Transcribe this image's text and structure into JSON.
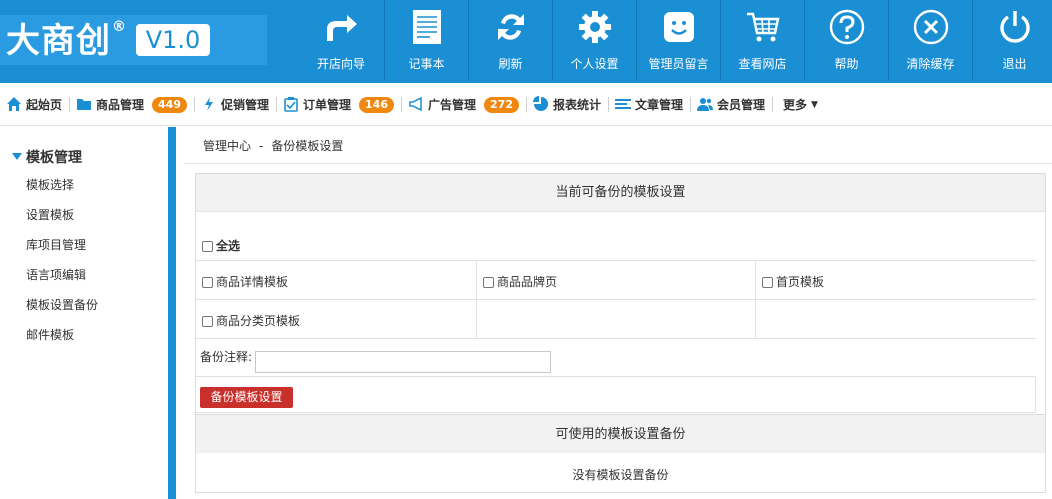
{
  "brand": {
    "name": "大商创",
    "reg": "®",
    "version": "V1.0"
  },
  "top_tools": [
    {
      "label": "开店向导",
      "icon": "share-arrow-icon"
    },
    {
      "label": "记事本",
      "icon": "notepad-icon"
    },
    {
      "label": "刷新",
      "icon": "refresh-icon"
    },
    {
      "label": "个人设置",
      "icon": "gear-icon"
    },
    {
      "label": "管理员留言",
      "icon": "message-face-icon"
    },
    {
      "label": "查看网店",
      "icon": "shopping-cart-icon"
    },
    {
      "label": "帮助",
      "icon": "help-icon"
    },
    {
      "label": "清除缓存",
      "icon": "clear-cache-icon"
    },
    {
      "label": "退出",
      "icon": "power-icon"
    }
  ],
  "nav": [
    {
      "label": "起始页",
      "icon": "home-icon"
    },
    {
      "label": "商品管理",
      "icon": "folder-icon",
      "badge": "449"
    },
    {
      "label": "促销管理",
      "icon": "lightning-icon"
    },
    {
      "label": "订单管理",
      "icon": "clipboard-icon",
      "badge": "146"
    },
    {
      "label": "广告管理",
      "icon": "megaphone-icon",
      "badge": "272"
    },
    {
      "label": "报表统计",
      "icon": "pie-chart-icon"
    },
    {
      "label": "文章管理",
      "icon": "list-icon"
    },
    {
      "label": "会员管理",
      "icon": "users-icon"
    },
    {
      "label": "更多",
      "icon": ""
    }
  ],
  "sidebar": {
    "title": "模板管理",
    "items": [
      "模板选择",
      "设置模板",
      "库项目管理",
      "语言项编辑",
      "模板设置备份",
      "邮件模板"
    ]
  },
  "breadcrumb": {
    "root": "管理中心",
    "sep": "-",
    "current": "备份模板设置"
  },
  "panel": {
    "title": "当前可备份的模板设置",
    "select_all": "全选",
    "templates": [
      "商品详情模板",
      "商品品牌页",
      "首页模板",
      "商品分类页模板"
    ],
    "note_label": "备份注释:",
    "note_value": "",
    "backup_button": "备份模板设置",
    "available_title": "可使用的模板设置备份",
    "empty_text": "没有模板设置备份"
  },
  "colors": {
    "primary": "#1b8fd3",
    "badge": "#f0880f",
    "danger": "#c9302c"
  }
}
